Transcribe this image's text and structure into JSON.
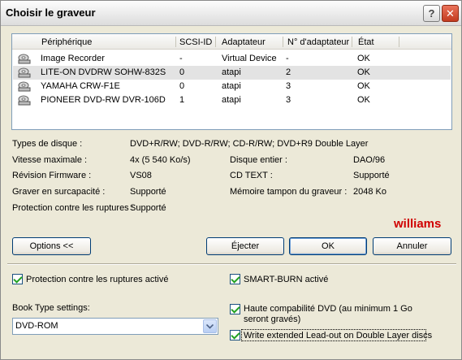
{
  "window": {
    "title": "Choisir le graveur"
  },
  "titlebar": {
    "help_label": "?",
    "close_label": "✕"
  },
  "list": {
    "headers": [
      "Périphérique",
      "SCSI-ID",
      "Adaptateur",
      "N° d'adaptateur",
      "État"
    ],
    "rows": [
      {
        "device": "Image Recorder",
        "scsi": "-",
        "adapter": "Virtual Device",
        "adapter_no": "-",
        "state": "OK"
      },
      {
        "device": "LITE-ON  DVDRW SOHW-832S",
        "scsi": "0",
        "adapter": "atapi",
        "adapter_no": "2",
        "state": "OK"
      },
      {
        "device": "YAMAHA   CRW-F1E",
        "scsi": "0",
        "adapter": "atapi",
        "adapter_no": "3",
        "state": "OK"
      },
      {
        "device": "PIONEER  DVD-RW  DVR-106D",
        "scsi": "1",
        "adapter": "atapi",
        "adapter_no": "3",
        "state": "OK"
      }
    ]
  },
  "info": {
    "disc_types_label": "Types de disque :",
    "disc_types_value": "DVD+R/RW; DVD-R/RW; CD-R/RW; DVD+R9 Double Layer",
    "max_speed_label": "Vitesse maximale :",
    "max_speed_value": "4x (5 540 Ko/s)",
    "whole_disc_label": "Disque entier :",
    "whole_disc_value": "DAO/96",
    "firmware_label": "Révision Firmware :",
    "firmware_value": "VS08",
    "cdtext_label": "CD TEXT :",
    "cdtext_value": "Supporté",
    "overburn_label": "Graver en surcapacité :",
    "overburn_value": "Supporté",
    "buffer_label": "Mémoire tampon du graveur :",
    "buffer_value": "2048 Ko",
    "protection_label": "Protection contre les ruptures :",
    "protection_value": "Supporté"
  },
  "brand": "williams",
  "buttons": {
    "options": "Options <<",
    "eject": "Éjecter",
    "ok": "OK",
    "cancel": "Annuler"
  },
  "options": {
    "underrun": "Protection contre les ruptures activé",
    "smartburn": "SMART-BURN activé",
    "booktype_label": "Book Type settings:",
    "booktype_value": "DVD-ROM",
    "hicompat": "Haute compabilité DVD (au minimum 1 Go seront gravés)",
    "leadout": "Write extended Lead-out on Double Layer discs"
  }
}
